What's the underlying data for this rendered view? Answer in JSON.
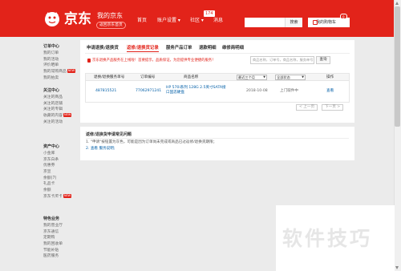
{
  "header": {
    "logo_text": "京东",
    "myjd": "我的京东",
    "back_home": "返回京东首页",
    "nav": [
      "首页",
      "账户设置 ▾",
      "社区 ▾",
      "消息"
    ],
    "message_badge": "174",
    "search_placeholder": "",
    "search_button": "搜索",
    "cart_label": "我的购物车",
    "cart_badge": "0"
  },
  "sidebar": {
    "groups": [
      {
        "title": "订单中心",
        "items": [
          {
            "label": "我的订单"
          },
          {
            "label": "我的活动"
          },
          {
            "label": "评价晒单"
          },
          {
            "label": "我的常购商品",
            "tag": "NEW"
          },
          {
            "label": "我的拍卖"
          }
        ]
      },
      {
        "title": "关注中心",
        "items": [
          {
            "label": "关注的商品"
          },
          {
            "label": "关注的店铺"
          },
          {
            "label": "关注的专辑"
          },
          {
            "label": "收藏的内容",
            "tag": "NEW"
          },
          {
            "label": "关注的活动"
          }
        ]
      },
      {
        "title": "资产中心",
        "items": [
          {
            "label": "小金库"
          },
          {
            "label": "京东白条"
          },
          {
            "label": "优惠券"
          },
          {
            "label": "京豆"
          },
          {
            "label": "余额(7)"
          },
          {
            "label": "礼品卡"
          },
          {
            "label": "余额"
          },
          {
            "label": "京东卡/E卡",
            "tag": "NEW"
          }
        ]
      },
      {
        "title": "特色业务",
        "items": [
          {
            "label": "我的营业厅"
          },
          {
            "label": "京东通信"
          },
          {
            "label": "定期购"
          },
          {
            "label": "我的回收单"
          },
          {
            "label": "节能补贴"
          },
          {
            "label": "医药服务"
          }
        ]
      }
    ]
  },
  "tabs": [
    "申请退换/退换货",
    "返修/退换货记录",
    "服务产品订单",
    "退款明细",
    "维修商明细"
  ],
  "notice": "京东退换产品服务在上线啦！首要提示，品质保证，为您提供专业便捷的服务！",
  "search_input_placeholder": "商品名称，订单号，商品名称，服务单号",
  "query_button": "查询",
  "table": {
    "headers": {
      "service_no": "退换/退换服务单号",
      "order_no": "订单编号",
      "product": "商品名称",
      "time": "最近三个月",
      "status": "全部状态",
      "action": "操作"
    },
    "rows": [
      {
        "service_no": "487815521",
        "order_no": "77062971241",
        "product": "HP 570i系列 128G 2.5英寸SATA接口固态硬盘",
        "time": "2018-10-08",
        "status": "上门取件中",
        "action": "查看"
      }
    ]
  },
  "pager": {
    "prev": "< 上一页",
    "next": "下一页 >"
  },
  "faq": {
    "title": "返修/退换货申请常见问题",
    "items": [
      "1. \"申请\"按钮置为灰色，可能是因为订单尚未完成或商品已过返修/退换货期限；",
      "2. 查看 服务说明;"
    ]
  },
  "watermark": "软件技巧",
  "colors": {
    "brand": "#e2231a",
    "link": "#005ea7"
  }
}
